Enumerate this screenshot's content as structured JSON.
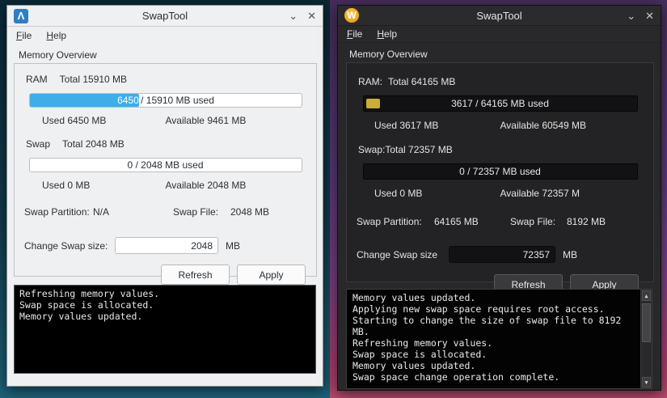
{
  "icons": {
    "left_app": "Λ",
    "right_app": "W",
    "chevron": "⌄",
    "close": "✕",
    "scroll_up": "▲",
    "scroll_down": "▼"
  },
  "left_window": {
    "title": "SwapTool",
    "menu": [
      "File",
      "Help"
    ],
    "section_title": "Memory Overview",
    "accent_color": "#3daee9",
    "ram": {
      "name": "RAM",
      "total": "Total 15910 MB",
      "bar_text": "6450 / 15910 MB used",
      "fill_percent": 40.2,
      "fill_color": "#3daee9",
      "used": "Used 6450 MB",
      "available": "Available 9461 MB"
    },
    "swap": {
      "name": "Swap",
      "total": "Total 2048 MB",
      "bar_text": "0 / 2048 MB used",
      "fill_percent": 0,
      "fill_color": "#3daee9",
      "used": "Used 0 MB",
      "available": "Available 2048 MB"
    },
    "swap_partition_label": "Swap Partition:",
    "swap_partition_value": "N/A",
    "swap_file_label": "Swap File:",
    "swap_file_value": "2048 MB",
    "change_label": "Change Swap size:",
    "change_value": "2048",
    "unit": "MB",
    "refresh_label": "Refresh",
    "apply_label": "Apply",
    "console_lines": [
      "Refreshing memory values.",
      "Swap space is allocated.",
      "Memory values updated."
    ]
  },
  "right_window": {
    "title": "SwapTool",
    "menu": [
      "File",
      "Help"
    ],
    "section_title": "Memory Overview",
    "accent_color": "#c9ac3a",
    "ram": {
      "name": "RAM:",
      "total": "Total 64165 MB",
      "bar_text": "3617 / 64165 MB used",
      "fill_percent": 5.3,
      "fill_color": "#c9ac3a",
      "used": "Used 3617 MB",
      "available": "Available 60549 MB"
    },
    "swap": {
      "name": "Swap:",
      "total": "Total 72357 MB",
      "bar_text": "0 / 72357 MB used",
      "fill_percent": 0,
      "fill_color": "#c9ac3a",
      "used": "Used 0 MB",
      "available": "Available 72357 M"
    },
    "swap_partition_label": "Swap Partition:",
    "swap_partition_value": "64165 MB",
    "swap_file_label": "Swap File:",
    "swap_file_value": "8192 MB",
    "change_label": "Change Swap size",
    "change_value": "72357",
    "unit": "MB",
    "refresh_label": "Refresh",
    "apply_label": "Apply",
    "console_lines": [
      "Memory values updated.",
      "Applying new swap space requires root access.",
      "Starting to change the size of swap file to 8192 MB.",
      "Refreshing memory values.",
      "Swap space is allocated.",
      "Memory values updated.",
      "Swap space change operation complete."
    ]
  }
}
